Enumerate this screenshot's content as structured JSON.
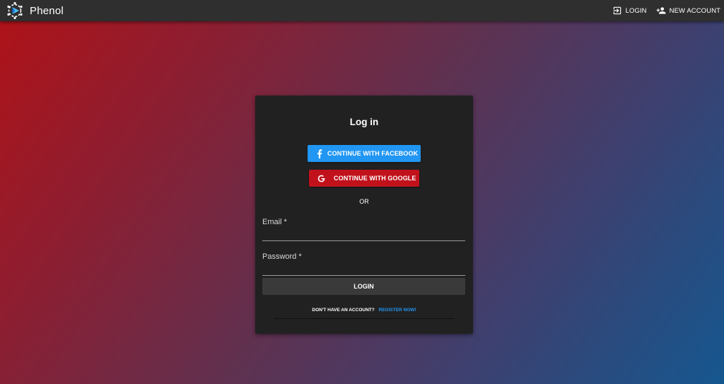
{
  "app": {
    "name": "Phenol",
    "logo_icon": "atom-gear-logo-icon"
  },
  "nav": {
    "login_label": "LOGIN",
    "login_icon": "login-icon",
    "new_account_label": "NEW ACCOUNT",
    "new_account_icon": "add-person-icon"
  },
  "login_card": {
    "title": "Log in",
    "facebook_label": "CONTINUE WITH FACEBOOK",
    "facebook_icon": "facebook-icon",
    "google_label": "CONTINUE WITH GOOGLE",
    "google_icon": "google-icon",
    "or_label": "OR",
    "email_label": "Email *",
    "email_value": "",
    "password_label": "Password *",
    "password_value": "",
    "login_button": "LOGIN",
    "no_account_text": "DON'T HAVE AN ACCOUNT?",
    "register_link": "REGISTER NOW!"
  },
  "colors": {
    "topbar": "#2f2f2f",
    "card": "#212121",
    "facebook": "#2196f3",
    "google": "#c1121c",
    "link": "#2196f3",
    "gradient_start": "#b01217",
    "gradient_end": "#15578f"
  }
}
